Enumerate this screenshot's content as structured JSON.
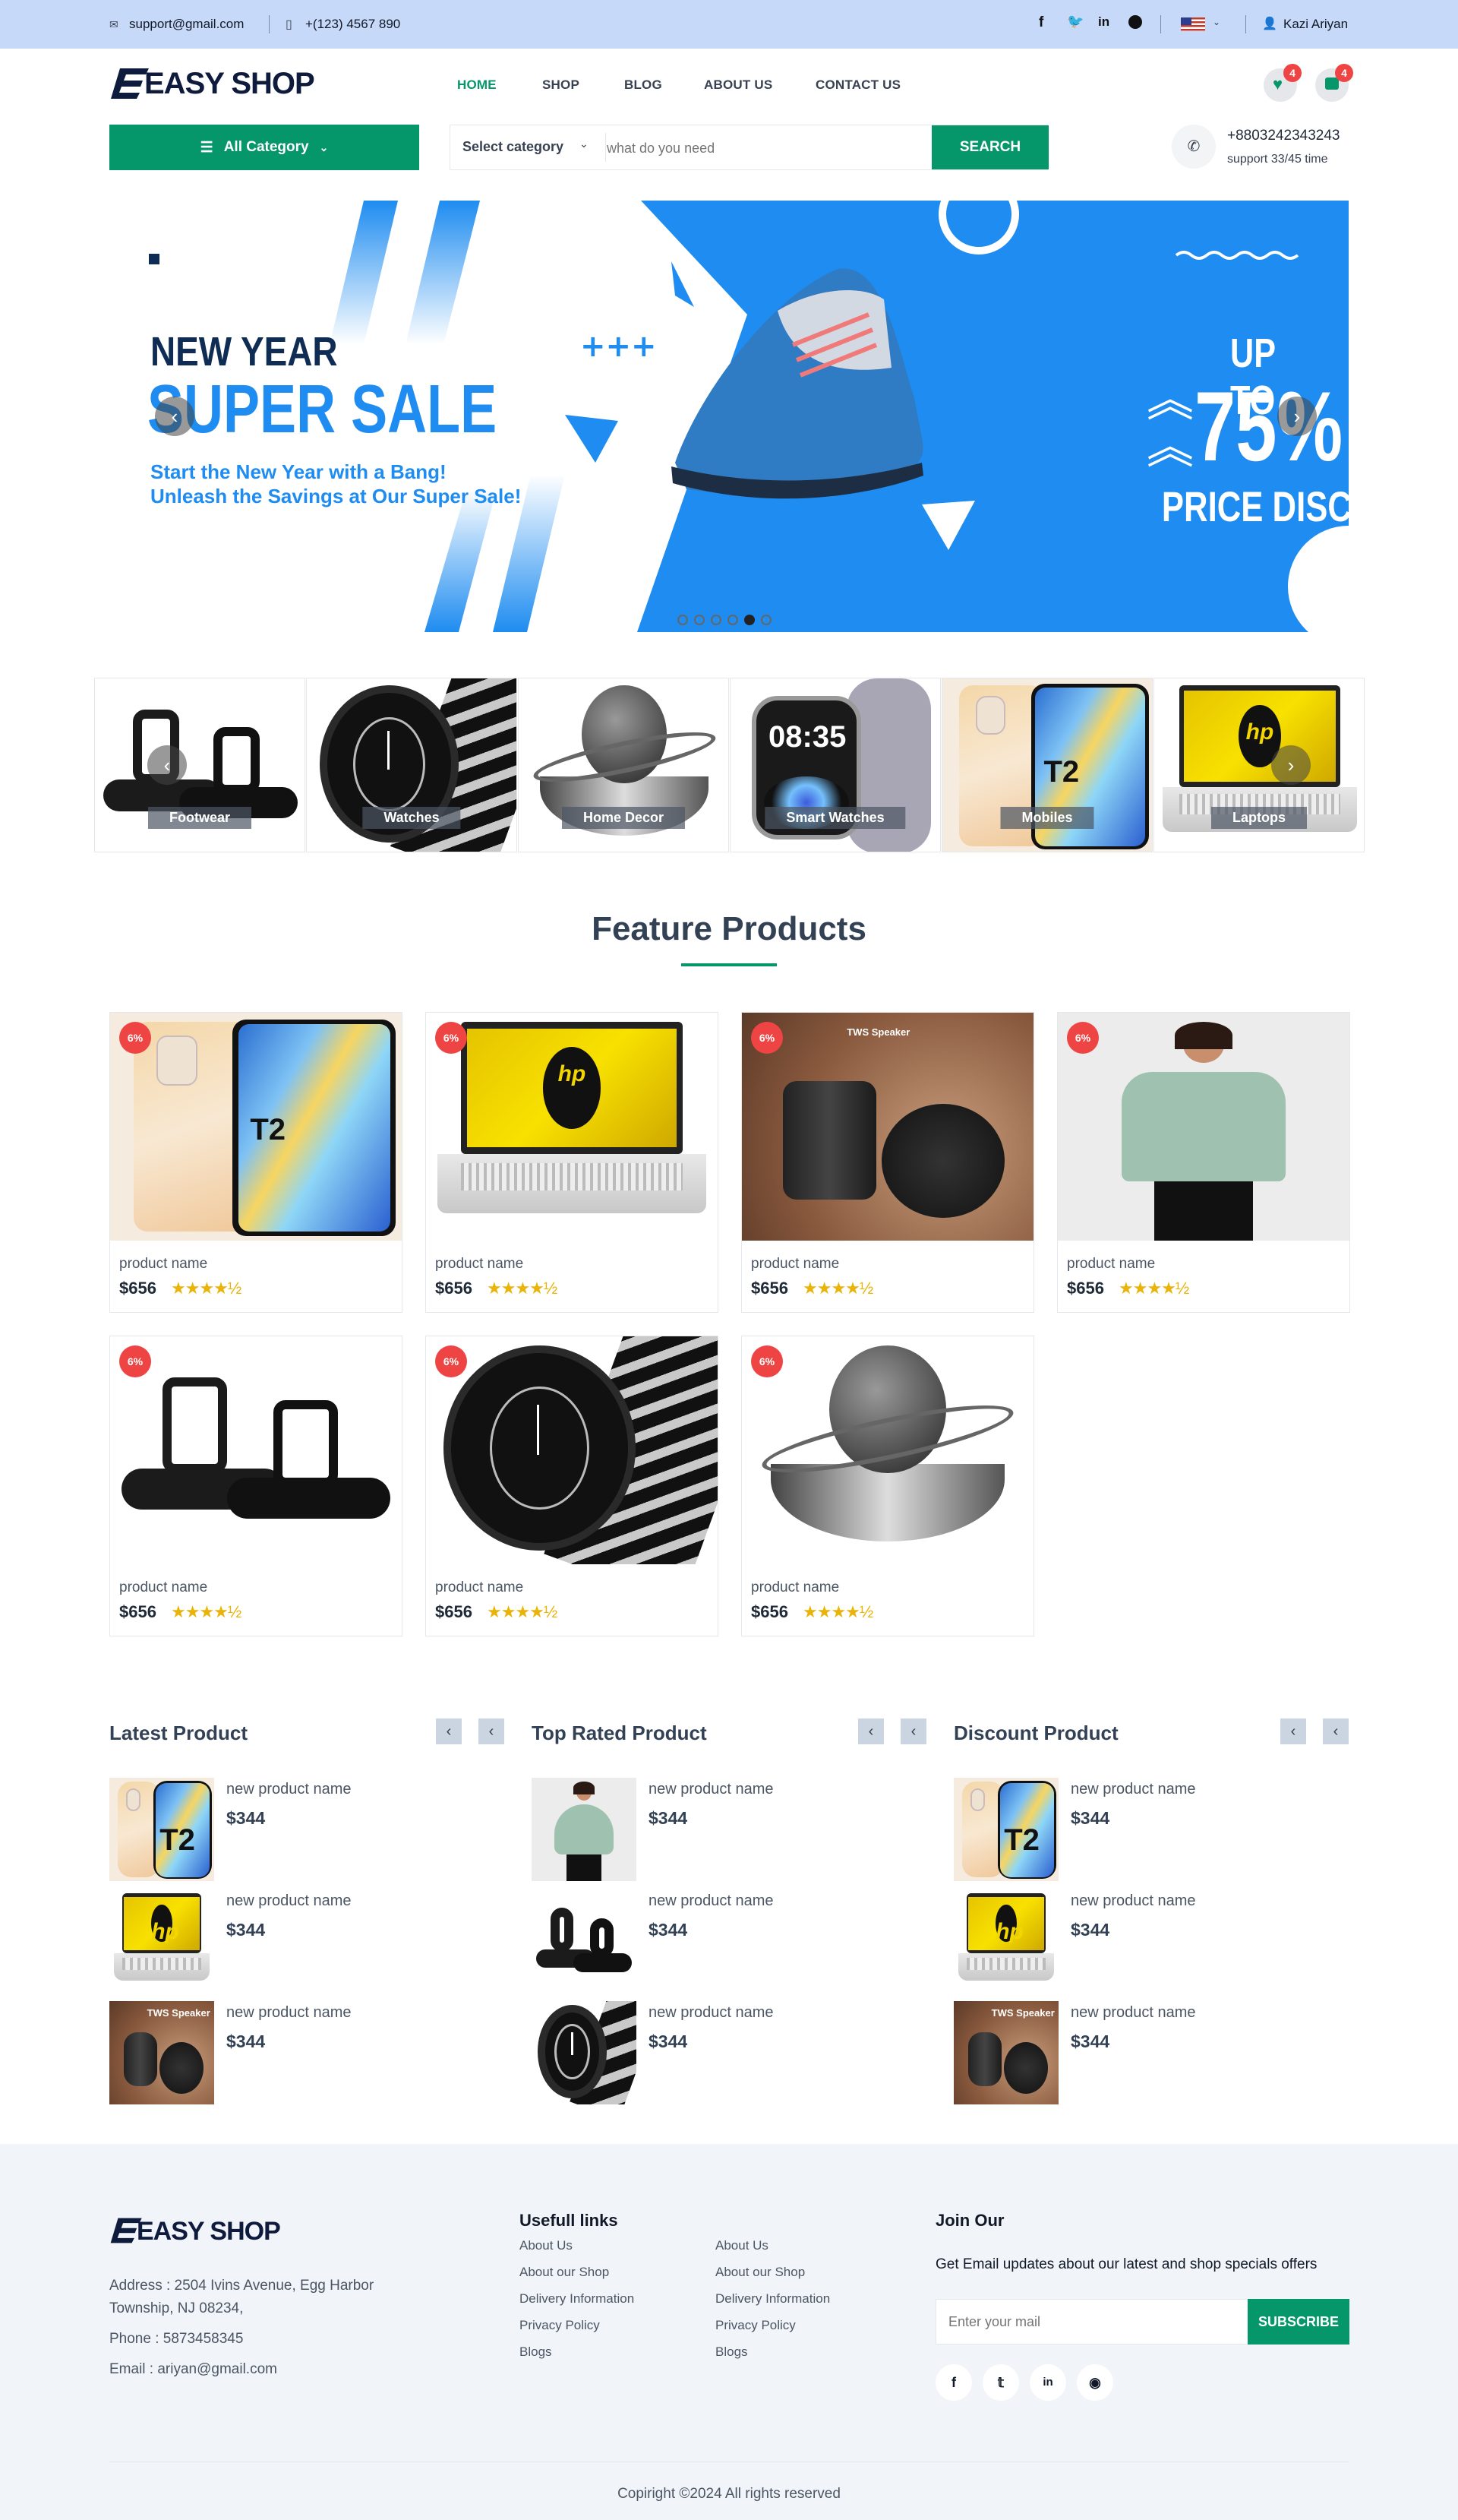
{
  "topbar": {
    "email": "support@gmail.com",
    "phone": "+(123) 4567 890",
    "user": "Kazi Ariyan",
    "social": [
      "facebook-icon",
      "twitter-icon",
      "linkedin-icon",
      "github-icon"
    ]
  },
  "header": {
    "logo": "EASY SHOP",
    "nav": [
      "HOME",
      "SHOP",
      "BLOG",
      "ABOUT US",
      "CONTACT US"
    ],
    "wishlist_count": "4",
    "cart_count": "4"
  },
  "searchbar": {
    "all_category": "All Category",
    "select_category": "Select category",
    "placeholder": "what do you need",
    "search_label": "SEARCH",
    "support_phone": "+8803242343243",
    "support_time": "support 33/45 time"
  },
  "banner": {
    "line1": "NEW YEAR",
    "line2": "SUPER SALE",
    "tagline1": "Start the New Year with a Bang!",
    "tagline2": "Unleash the Savings at Our Super Sale!",
    "up_to": "UP TO",
    "percent": "75%",
    "discount": "PRICE DISCOUNT"
  },
  "categories": [
    "Footwear",
    "Watches",
    "Home Decor",
    "Smart Watches",
    "Mobiles",
    "Laptops"
  ],
  "featured": {
    "title": "Feature Products",
    "products": [
      {
        "name": "product name",
        "price": "$656",
        "discount": "6%",
        "img": "phone"
      },
      {
        "name": "product name",
        "price": "$656",
        "discount": "6%",
        "img": "laptop"
      },
      {
        "name": "product name",
        "price": "$656",
        "discount": "6%",
        "img": "speaker"
      },
      {
        "name": "product name",
        "price": "$656",
        "discount": "6%",
        "img": "shirt"
      },
      {
        "name": "product name",
        "price": "$656",
        "discount": "6%",
        "img": "sandal"
      },
      {
        "name": "product name",
        "price": "$656",
        "discount": "6%",
        "img": "watch"
      },
      {
        "name": "product name",
        "price": "$656",
        "discount": "6%",
        "img": "decor"
      }
    ],
    "stars": "★★★★½"
  },
  "lists": [
    {
      "title": "Latest Product",
      "items": [
        {
          "name": "new product name",
          "price": "$344",
          "img": "phone"
        },
        {
          "name": "new product name",
          "price": "$344",
          "img": "laptop"
        },
        {
          "name": "new product name",
          "price": "$344",
          "img": "speaker"
        }
      ]
    },
    {
      "title": "Top Rated Product",
      "items": [
        {
          "name": "new product name",
          "price": "$344",
          "img": "shirt"
        },
        {
          "name": "new product name",
          "price": "$344",
          "img": "sandal"
        },
        {
          "name": "new product name",
          "price": "$344",
          "img": "watch"
        }
      ]
    },
    {
      "title": "Discount Product",
      "items": [
        {
          "name": "new product name",
          "price": "$344",
          "img": "phone"
        },
        {
          "name": "new product name",
          "price": "$344",
          "img": "laptop"
        },
        {
          "name": "new product name",
          "price": "$344",
          "img": "speaker"
        }
      ]
    }
  ],
  "footer": {
    "logo": "EASY SHOP",
    "address": "Address : 2504 Ivins Avenue, Egg Harbor Township, NJ 08234,",
    "phone": "Phone : 5873458345",
    "email": "Email : ariyan@gmail.com",
    "links_title": "Usefull links",
    "links": [
      "About Us",
      "About our Shop",
      "Delivery Information",
      "Privacy Policy",
      "Blogs"
    ],
    "join_title": "Join Our",
    "join_text": "Get Email updates about our latest and shop specials offers",
    "mail_placeholder": "Enter your mail",
    "subscribe": "SUBSCRIBE",
    "copyright": "Copiright ©2024 All rights reserved"
  }
}
